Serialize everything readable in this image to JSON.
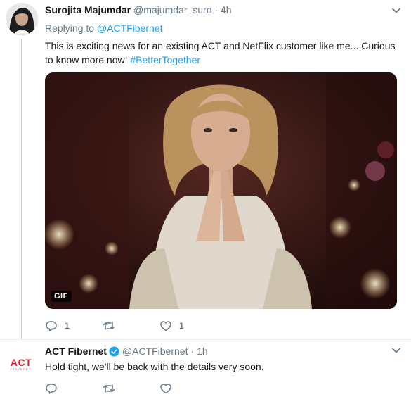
{
  "colors": {
    "link": "#1da1f2",
    "muted": "#657786",
    "text": "#14171a",
    "act_red": "#e4202a"
  },
  "tweet1": {
    "name": "Surojita Majumdar",
    "handle": "@majumdar_suro",
    "dot": "·",
    "time": "4h",
    "reply_prefix": "Replying to",
    "reply_to": "@ACTFibernet",
    "text": "This is exciting news for an existing ACT and NetFlix customer like me... Curious to know more now!",
    "hashtag": "#BetterTogether",
    "media_badge": "GIF",
    "reply_count": "1",
    "retweet_count": "",
    "like_count": "1"
  },
  "tweet2": {
    "name": "ACT Fibernet",
    "handle": "@ACTFibernet",
    "dot": "·",
    "time": "1h",
    "text": "Hold tight, we'll be back with the details very soon.",
    "logo_text": "ACT",
    "logo_subtext": "FIBERNET"
  },
  "icons": [
    "caret-down-icon",
    "reply-icon",
    "retweet-icon",
    "like-icon",
    "verified-icon"
  ]
}
